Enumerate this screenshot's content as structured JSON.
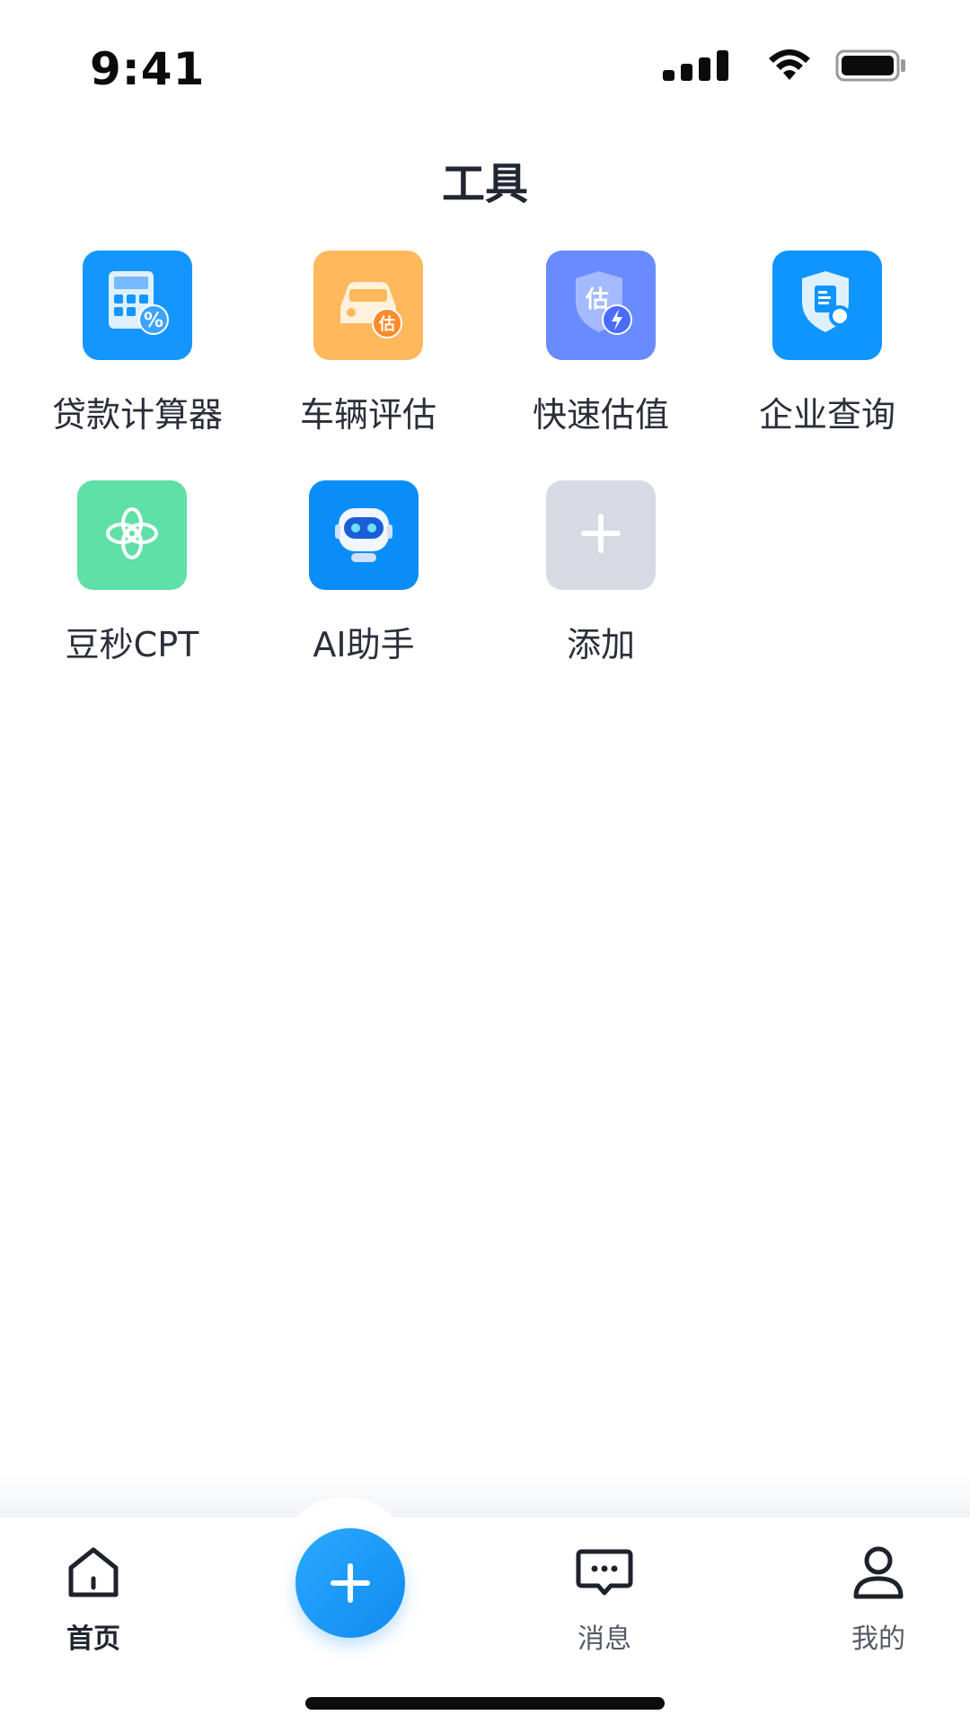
{
  "status_bar": {
    "time": "9:41",
    "icons": [
      "cellular-signal-icon",
      "wifi-icon",
      "battery-icon"
    ]
  },
  "header": {
    "title": "工具"
  },
  "tools": [
    {
      "label": "贷款计算器",
      "icon": "calculator-percent-icon",
      "color": "#1596FF"
    },
    {
      "label": "车辆评估",
      "icon": "car-estimate-icon",
      "color": "#FFB85C"
    },
    {
      "label": "快速估值",
      "icon": "shield-estimate-bolt-icon",
      "color": "#6A8BFF"
    },
    {
      "label": "企业查询",
      "icon": "shield-document-search-icon",
      "color": "#0E95FF"
    },
    {
      "label": "豆秒CPT",
      "icon": "openai-knot-icon",
      "color": "#5EE0A6"
    },
    {
      "label": "AI助手",
      "icon": "robot-assistant-icon",
      "color": "#0B8DF8"
    },
    {
      "label": "添加",
      "icon": "plus-icon",
      "color": "#D7DAE3"
    }
  ],
  "bottom_nav": {
    "items": [
      {
        "label": "首页",
        "icon": "home-icon",
        "active": true
      },
      {
        "label": "消息",
        "icon": "message-bubble-icon",
        "active": false
      },
      {
        "label": "我的",
        "icon": "user-profile-icon",
        "active": false
      }
    ],
    "fab_icon": "plus-icon",
    "fab_color": "#1A9BF8"
  }
}
